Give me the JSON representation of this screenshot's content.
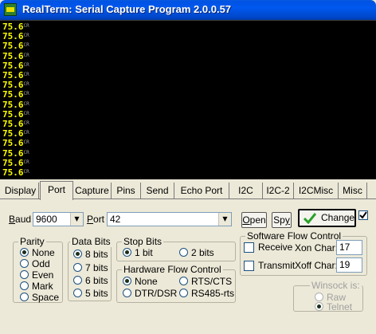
{
  "window": {
    "title": "RealTerm: Serial Capture Program 2.0.0.57"
  },
  "terminal": {
    "lines": [
      "75.6",
      "75.6",
      "75.6",
      "75.6",
      "75.6",
      "75.6",
      "75.6",
      "75.6",
      "75.6",
      "75.6",
      "75.6",
      "75.6",
      "75.6",
      "75.6",
      "75.6",
      "75.6"
    ],
    "line_end_glyph": "CR",
    "text_color": "#ffff00",
    "background": "#000000"
  },
  "tabs": [
    {
      "label": "Display",
      "active": false
    },
    {
      "label": "Port",
      "active": true
    },
    {
      "label": "Capture",
      "active": false
    },
    {
      "label": "Pins",
      "active": false
    },
    {
      "label": "Send",
      "active": false
    },
    {
      "label": "Echo Port",
      "active": false
    },
    {
      "label": "I2C",
      "active": false
    },
    {
      "label": "I2C-2",
      "active": false
    },
    {
      "label": "I2CMisc",
      "active": false
    },
    {
      "label": "Misc",
      "active": false
    }
  ],
  "port": {
    "baud_label": "Baud",
    "baud_value": "9600",
    "port_label": "Port",
    "port_value": "42",
    "open_label": "Open",
    "spy_label": "Spy",
    "change_label": "Change",
    "change_icon": "checkmark-icon",
    "accent": "#2aa02a"
  },
  "parity": {
    "title": "Parity",
    "options": [
      "None",
      "Odd",
      "Even",
      "Mark",
      "Space"
    ],
    "selected": "None"
  },
  "data_bits": {
    "title": "Data Bits",
    "options": [
      "8 bits",
      "7 bits",
      "6 bits",
      "5 bits"
    ],
    "selected": "8 bits"
  },
  "stop_bits": {
    "title": "Stop Bits",
    "options": [
      "1 bit",
      "2 bits"
    ],
    "selected": "1 bit"
  },
  "hardware_flow": {
    "title": "Hardware Flow Control",
    "options": [
      "None",
      "RTS/CTS",
      "DTR/DSR",
      "RS485-rts"
    ],
    "selected": "None"
  },
  "software_flow": {
    "title": "Software Flow Control",
    "receive_label": "Receive",
    "transmit_label": "Transmit",
    "xon_label": "Xon Char:",
    "xon_value": "17",
    "xoff_label": "Xoff Char:",
    "xoff_value": "19"
  },
  "winsock": {
    "title": "Winsock is:",
    "options": [
      "Raw",
      "Telnet"
    ],
    "selected": "Telnet"
  }
}
